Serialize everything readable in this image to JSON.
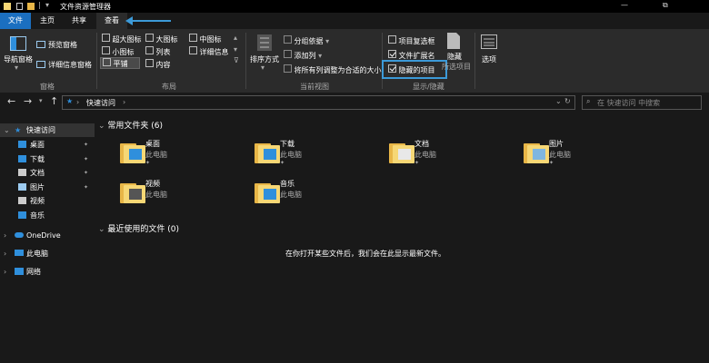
{
  "window": {
    "title": "文件资源管理器",
    "controls": {
      "minimize": "—",
      "maximize": "⧉"
    }
  },
  "tabs": {
    "file": "文件",
    "home": "主页",
    "share": "共享",
    "view": "查看"
  },
  "ribbon": {
    "panes": {
      "nav_pane": "导航窗格",
      "preview_pane": "预览窗格",
      "details_pane": "详细信息窗格",
      "group_label": "窗格"
    },
    "layout": {
      "xl_icons": "超大图标",
      "large_icons": "大图标",
      "medium_icons": "中图标",
      "small_icons": "小图标",
      "list": "列表",
      "details": "详细信息",
      "tiles": "平铺",
      "content": "内容",
      "group_label": "布局"
    },
    "current_view": {
      "sort_by": "排序方式",
      "group_by": "分组依据",
      "add_columns": "添加列",
      "size_all_columns": "将所有列调整为合适的大小",
      "group_label": "当前视图"
    },
    "show_hide": {
      "item_checkboxes": "项目复选框",
      "file_extensions": "文件扩展名",
      "hidden_items": "隐藏的项目",
      "hide_selected": "隐藏",
      "hide_selected2": "所选项目",
      "group_label": "显示/隐藏",
      "item_checkboxes_on": false,
      "file_extensions_on": true,
      "hidden_items_on": true
    },
    "options": "选项"
  },
  "address": {
    "path": "快速访问",
    "search_placeholder": "在 快速访问 中搜索"
  },
  "sidebar": {
    "quick_access": "快速访问",
    "items": [
      {
        "label": "桌面",
        "pinned": true
      },
      {
        "label": "下载",
        "pinned": true
      },
      {
        "label": "文档",
        "pinned": true
      },
      {
        "label": "图片",
        "pinned": true
      },
      {
        "label": "视频",
        "pinned": false
      },
      {
        "label": "音乐",
        "pinned": false
      }
    ],
    "onedrive": "OneDrive",
    "this_pc": "此电脑",
    "network": "网络"
  },
  "main": {
    "frequent_header": "常用文件夹 (6)",
    "folders": [
      {
        "name": "桌面",
        "location": "此电脑"
      },
      {
        "name": "下载",
        "location": "此电脑"
      },
      {
        "name": "文档",
        "location": "此电脑"
      },
      {
        "name": "图片",
        "location": "此电脑"
      },
      {
        "name": "视频",
        "location": "此电脑"
      },
      {
        "name": "音乐",
        "location": "此电脑"
      }
    ],
    "recent_header": "最近使用的文件 (0)",
    "recent_empty": "在你打开某些文件后，我们会在此显示最新文件。"
  },
  "colors": {
    "accent": "#2f8fdc",
    "highlight_box": "#3c9ad8",
    "folder_yellow": "#f6d775"
  }
}
